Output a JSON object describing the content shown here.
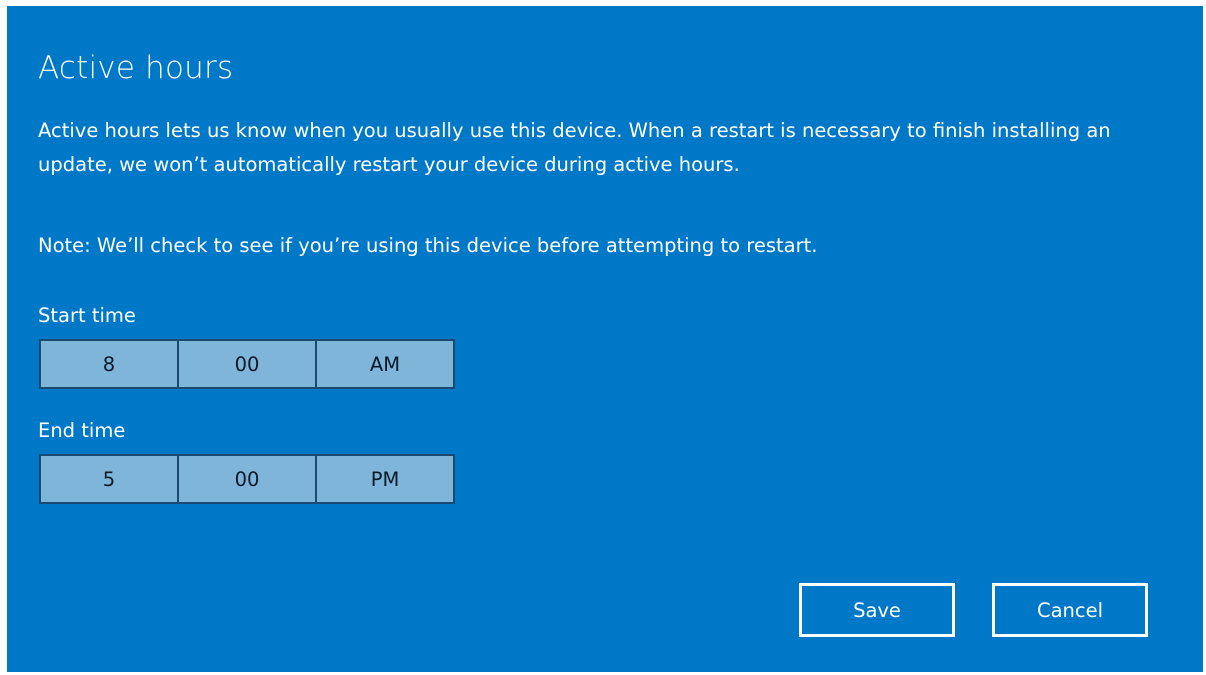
{
  "dialog": {
    "title": "Active hours",
    "description": "Active hours lets us know when you usually use this device. When a restart is necessary to finish installing an update, we won’t automatically restart your device during active hours.",
    "note": "Note: We’ll check to see if you’re using this device before attempting to restart."
  },
  "start_time": {
    "label": "Start time",
    "hour": "8",
    "minute": "00",
    "period": "AM"
  },
  "end_time": {
    "label": "End time",
    "hour": "5",
    "minute": "00",
    "period": "PM"
  },
  "buttons": {
    "save": "Save",
    "cancel": "Cancel"
  },
  "colors": {
    "background": "#0078c8",
    "picker_fill": "#7eb5d9",
    "picker_border": "#1a4a74",
    "text": "#ffffff"
  }
}
